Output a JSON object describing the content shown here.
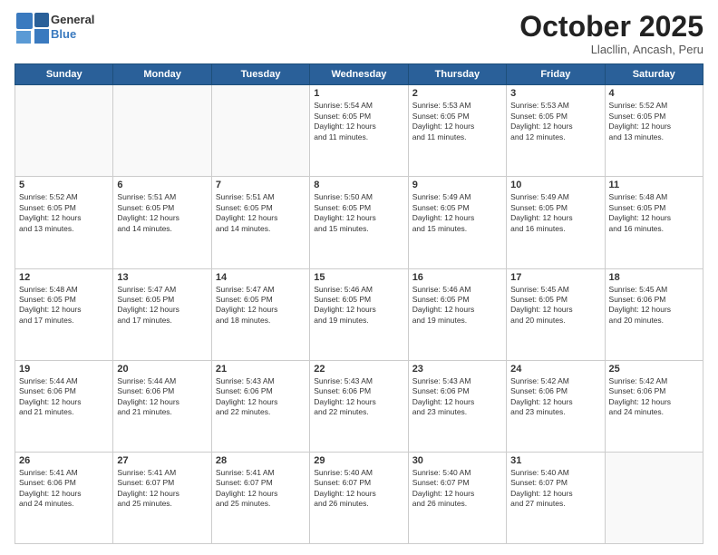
{
  "header": {
    "logo_general": "General",
    "logo_blue": "Blue",
    "month_title": "October 2025",
    "location": "Llacllin, Ancash, Peru"
  },
  "days_of_week": [
    "Sunday",
    "Monday",
    "Tuesday",
    "Wednesday",
    "Thursday",
    "Friday",
    "Saturday"
  ],
  "weeks": [
    [
      {
        "day": "",
        "info": ""
      },
      {
        "day": "",
        "info": ""
      },
      {
        "day": "",
        "info": ""
      },
      {
        "day": "1",
        "info": "Sunrise: 5:54 AM\nSunset: 6:05 PM\nDaylight: 12 hours\nand 11 minutes."
      },
      {
        "day": "2",
        "info": "Sunrise: 5:53 AM\nSunset: 6:05 PM\nDaylight: 12 hours\nand 11 minutes."
      },
      {
        "day": "3",
        "info": "Sunrise: 5:53 AM\nSunset: 6:05 PM\nDaylight: 12 hours\nand 12 minutes."
      },
      {
        "day": "4",
        "info": "Sunrise: 5:52 AM\nSunset: 6:05 PM\nDaylight: 12 hours\nand 13 minutes."
      }
    ],
    [
      {
        "day": "5",
        "info": "Sunrise: 5:52 AM\nSunset: 6:05 PM\nDaylight: 12 hours\nand 13 minutes."
      },
      {
        "day": "6",
        "info": "Sunrise: 5:51 AM\nSunset: 6:05 PM\nDaylight: 12 hours\nand 14 minutes."
      },
      {
        "day": "7",
        "info": "Sunrise: 5:51 AM\nSunset: 6:05 PM\nDaylight: 12 hours\nand 14 minutes."
      },
      {
        "day": "8",
        "info": "Sunrise: 5:50 AM\nSunset: 6:05 PM\nDaylight: 12 hours\nand 15 minutes."
      },
      {
        "day": "9",
        "info": "Sunrise: 5:49 AM\nSunset: 6:05 PM\nDaylight: 12 hours\nand 15 minutes."
      },
      {
        "day": "10",
        "info": "Sunrise: 5:49 AM\nSunset: 6:05 PM\nDaylight: 12 hours\nand 16 minutes."
      },
      {
        "day": "11",
        "info": "Sunrise: 5:48 AM\nSunset: 6:05 PM\nDaylight: 12 hours\nand 16 minutes."
      }
    ],
    [
      {
        "day": "12",
        "info": "Sunrise: 5:48 AM\nSunset: 6:05 PM\nDaylight: 12 hours\nand 17 minutes."
      },
      {
        "day": "13",
        "info": "Sunrise: 5:47 AM\nSunset: 6:05 PM\nDaylight: 12 hours\nand 17 minutes."
      },
      {
        "day": "14",
        "info": "Sunrise: 5:47 AM\nSunset: 6:05 PM\nDaylight: 12 hours\nand 18 minutes."
      },
      {
        "day": "15",
        "info": "Sunrise: 5:46 AM\nSunset: 6:05 PM\nDaylight: 12 hours\nand 19 minutes."
      },
      {
        "day": "16",
        "info": "Sunrise: 5:46 AM\nSunset: 6:05 PM\nDaylight: 12 hours\nand 19 minutes."
      },
      {
        "day": "17",
        "info": "Sunrise: 5:45 AM\nSunset: 6:05 PM\nDaylight: 12 hours\nand 20 minutes."
      },
      {
        "day": "18",
        "info": "Sunrise: 5:45 AM\nSunset: 6:06 PM\nDaylight: 12 hours\nand 20 minutes."
      }
    ],
    [
      {
        "day": "19",
        "info": "Sunrise: 5:44 AM\nSunset: 6:06 PM\nDaylight: 12 hours\nand 21 minutes."
      },
      {
        "day": "20",
        "info": "Sunrise: 5:44 AM\nSunset: 6:06 PM\nDaylight: 12 hours\nand 21 minutes."
      },
      {
        "day": "21",
        "info": "Sunrise: 5:43 AM\nSunset: 6:06 PM\nDaylight: 12 hours\nand 22 minutes."
      },
      {
        "day": "22",
        "info": "Sunrise: 5:43 AM\nSunset: 6:06 PM\nDaylight: 12 hours\nand 22 minutes."
      },
      {
        "day": "23",
        "info": "Sunrise: 5:43 AM\nSunset: 6:06 PM\nDaylight: 12 hours\nand 23 minutes."
      },
      {
        "day": "24",
        "info": "Sunrise: 5:42 AM\nSunset: 6:06 PM\nDaylight: 12 hours\nand 23 minutes."
      },
      {
        "day": "25",
        "info": "Sunrise: 5:42 AM\nSunset: 6:06 PM\nDaylight: 12 hours\nand 24 minutes."
      }
    ],
    [
      {
        "day": "26",
        "info": "Sunrise: 5:41 AM\nSunset: 6:06 PM\nDaylight: 12 hours\nand 24 minutes."
      },
      {
        "day": "27",
        "info": "Sunrise: 5:41 AM\nSunset: 6:07 PM\nDaylight: 12 hours\nand 25 minutes."
      },
      {
        "day": "28",
        "info": "Sunrise: 5:41 AM\nSunset: 6:07 PM\nDaylight: 12 hours\nand 25 minutes."
      },
      {
        "day": "29",
        "info": "Sunrise: 5:40 AM\nSunset: 6:07 PM\nDaylight: 12 hours\nand 26 minutes."
      },
      {
        "day": "30",
        "info": "Sunrise: 5:40 AM\nSunset: 6:07 PM\nDaylight: 12 hours\nand 26 minutes."
      },
      {
        "day": "31",
        "info": "Sunrise: 5:40 AM\nSunset: 6:07 PM\nDaylight: 12 hours\nand 27 minutes."
      },
      {
        "day": "",
        "info": ""
      }
    ]
  ]
}
